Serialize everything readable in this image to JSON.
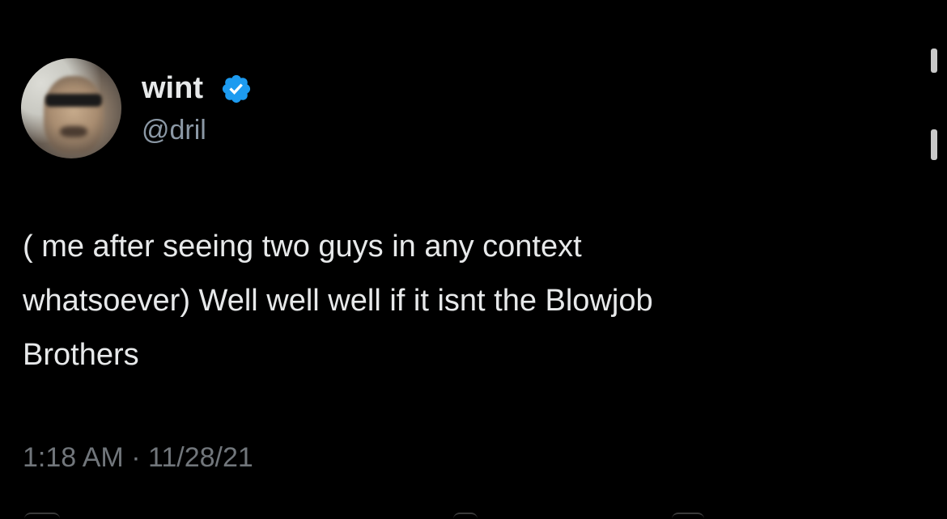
{
  "tweet": {
    "author": {
      "display_name": "wint",
      "handle": "@dril",
      "verified": true,
      "verified_color": "#1d9bf0"
    },
    "text_lines": [
      "( me after seeing two guys in any context",
      "whatsoever) Well well well if it isnt the Blowjob",
      "Brothers"
    ],
    "timestamp": "1:18 AM · 11/28/21"
  },
  "icons": {
    "verified": "verified-badge-icon",
    "avatar": "profile-avatar"
  },
  "colors": {
    "background": "#000000",
    "primary_text": "#e7e9ea",
    "secondary_text": "#8b98a5",
    "timestamp_text": "#71767b"
  }
}
